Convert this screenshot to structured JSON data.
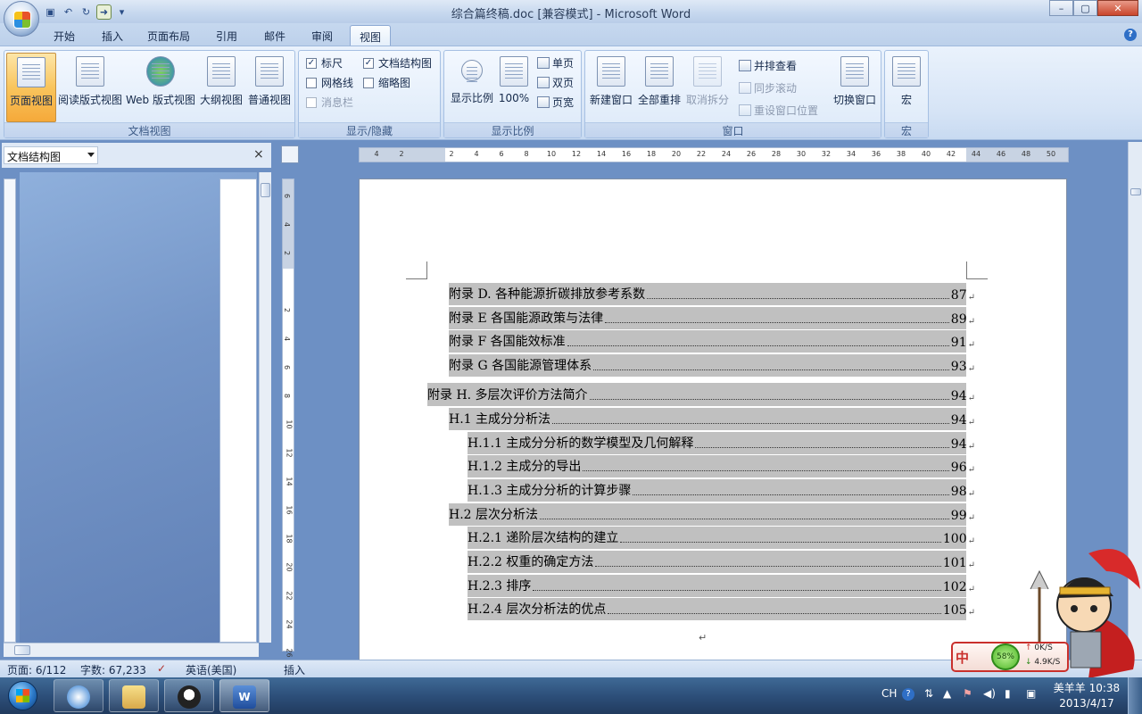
{
  "window": {
    "title": "综合篇终稿.doc [兼容模式] - Microsoft Word",
    "controls": {
      "minimize": "–",
      "maximize": "▢",
      "close": "✕"
    }
  },
  "quick_access": {
    "icons": [
      "save-icon",
      "undo-icon",
      "redo-icon",
      "refresh-icon",
      "forward-icon",
      "customize-icon"
    ],
    "redo_glyph": "↻",
    "save_glyph": "▣",
    "undo_glyph": "↶",
    "forward_glyph": "➜",
    "more_glyph": "▾"
  },
  "tabs": [
    "开始",
    "插入",
    "页面布局",
    "引用",
    "邮件",
    "审阅",
    "视图"
  ],
  "active_tab": "视图",
  "help_glyph": "?",
  "ribbon": {
    "doc_views": {
      "label": "文档视图",
      "buttons": [
        "页面视图",
        "阅读版式视图",
        "Web 版式视图",
        "大纲视图",
        "普通视图"
      ]
    },
    "show_hide": {
      "label": "显示/隐藏",
      "ruler": "标尺",
      "gridlines": "网格线",
      "message_bar": "消息栏",
      "doc_map": "文档结构图",
      "thumbnails": "缩略图",
      "check": "✓"
    },
    "zoom": {
      "label": "显示比例",
      "zoom_btn": "显示比例",
      "hundred": "100%",
      "one_page": "单页",
      "two_pages": "双页",
      "page_width": "页宽"
    },
    "window": {
      "label": "窗口",
      "new_window": "新建窗口",
      "arrange_all": "全部重排",
      "split": "取消拆分",
      "side_by_side": "并排查看",
      "sync_scroll": "同步滚动",
      "reset_pos": "重设窗口位置",
      "switch": "切换窗口"
    },
    "macros": {
      "label": "宏",
      "macro": "宏"
    }
  },
  "docmap": {
    "selector": "文档结构图",
    "close": "×"
  },
  "ruler": {
    "ticks": [
      "4",
      "2",
      "",
      "2",
      "4",
      "6",
      "8",
      "10",
      "12",
      "14",
      "16",
      "18",
      "20",
      "22",
      "24",
      "26",
      "28",
      "30",
      "32",
      "34",
      "36",
      "38",
      "40",
      "42",
      "44",
      "46",
      "48",
      "50"
    ],
    "vticks": [
      "6",
      "4",
      "2",
      "",
      "2",
      "4",
      "6",
      "8",
      "10",
      "12",
      "14",
      "16",
      "18",
      "20",
      "22",
      "24",
      "26"
    ]
  },
  "toc": [
    {
      "label": "附录 D. 各种能源折碳排放参考系数",
      "page": "87"
    },
    {
      "label": "附录 E 各国能源政策与法律",
      "page": "89"
    },
    {
      "label": "附录 F 各国能效标准",
      "page": "91"
    },
    {
      "label": "附录 G 各国能源管理体系",
      "page": "93"
    },
    {
      "label": "附录 H. 多层次评价方法简介",
      "page": "94"
    },
    {
      "label": "H.1  主成分分析法",
      "page": "94"
    },
    {
      "label": "H.1.1 主成分分析的数学模型及几何解释",
      "page": "94"
    },
    {
      "label": "H.1.2 主成分的导出",
      "page": "96"
    },
    {
      "label": "H.1.3 主成分分析的计算步骤",
      "page": "98"
    },
    {
      "label": "H.2  层次分析法",
      "page": "99"
    },
    {
      "label": "H.2.1 递阶层次结构的建立",
      "page": "100"
    },
    {
      "label": "H.2.2 权重的确定方法",
      "page": "101"
    },
    {
      "label": "H.2.3 排序",
      "page": "102"
    },
    {
      "label": "H.2.4 层次分析法的优点",
      "page": "105"
    }
  ],
  "para_mark": "↵",
  "status": {
    "page": "页面: 6/112",
    "words": "字数: 67,233",
    "language": "英语(美国)",
    "mode": "插入"
  },
  "netwidget": {
    "ime": "中",
    "percent": "58%",
    "up": "0K/S",
    "down": "4.9K/S",
    "up_arrow": "↑",
    "down_arrow": "↓"
  },
  "tray": {
    "lang": "CH",
    "help": "?"
  },
  "clock": {
    "user_time": "美羊羊 10:38",
    "date": "2013/4/17"
  },
  "colors": {
    "accent": "#6d90c4",
    "toc_highlight": "#c0c0c0",
    "active_view": "#f9c55d"
  }
}
